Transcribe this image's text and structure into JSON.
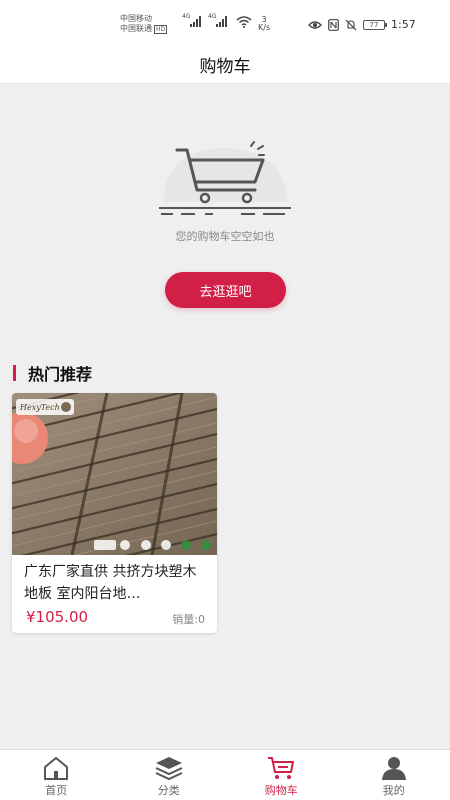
{
  "status_bar": {
    "carrier_1": "中国移动",
    "carrier_2": "中国联通",
    "hd_badge": "HD",
    "signal_1_tag": "4G",
    "signal_2_tag": "4G",
    "net_speed_value": "3",
    "net_speed_unit": "K/s",
    "battery": "77",
    "time": "1:57"
  },
  "header": {
    "title": "购物车"
  },
  "empty_cart": {
    "message": "您的购物车空空如也",
    "button_label": "去逛逛吧"
  },
  "hot_section": {
    "title": "热门推荐",
    "products": [
      {
        "name": "广东厂家直供 共挤方块塑木地板 室内阳台地…",
        "price": "¥105.00",
        "sales": "销量:0"
      }
    ]
  },
  "tab_bar": {
    "items": [
      {
        "label": "首页",
        "icon": "home-icon"
      },
      {
        "label": "分类",
        "icon": "layers-icon"
      },
      {
        "label": "购物车",
        "icon": "cart-icon",
        "active": true
      },
      {
        "label": "我的",
        "icon": "user-icon"
      }
    ]
  },
  "colors": {
    "accent": "#d21f47",
    "page_background": "#efefef",
    "text_muted": "#888888"
  }
}
